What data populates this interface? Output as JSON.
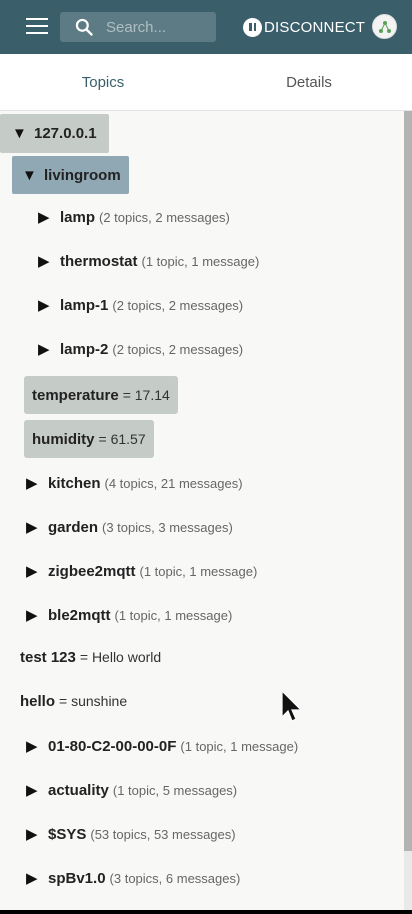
{
  "header": {
    "search_placeholder": "Search...",
    "disconnect_label": "DISCONNECT",
    "icons": {
      "menu": "menu-icon",
      "search": "search-icon",
      "pause": "pause-icon",
      "avatar": "avatar-icon"
    }
  },
  "tabs": [
    {
      "label": "Topics",
      "active": true
    },
    {
      "label": "Details",
      "active": false
    }
  ],
  "tree": {
    "broker": "127.0.0.1",
    "livingroom": {
      "name": "livingroom",
      "children": [
        {
          "name": "lamp",
          "meta": "(2 topics, 2 messages)"
        },
        {
          "name": "thermostat",
          "meta": "(1 topic, 1 message)"
        },
        {
          "name": "lamp-1",
          "meta": "(2 topics, 2 messages)"
        },
        {
          "name": "lamp-2",
          "meta": "(2 topics, 2 messages)"
        }
      ],
      "values": [
        {
          "name": "temperature",
          "value": "= 17.14"
        },
        {
          "name": "humidity",
          "value": "= 61.57"
        }
      ]
    },
    "groups": [
      {
        "name": "kitchen",
        "meta": "(4 topics, 21 messages)"
      },
      {
        "name": "garden",
        "meta": "(3 topics, 3 messages)"
      },
      {
        "name": "zigbee2mqtt",
        "meta": "(1 topic, 1 message)"
      },
      {
        "name": "ble2mqtt",
        "meta": "(1 topic, 1 message)"
      }
    ],
    "leaf_values": [
      {
        "name": "test 123",
        "value": "= Hello world"
      },
      {
        "name": "hello",
        "value": "= sunshine"
      }
    ],
    "more_groups": [
      {
        "name": "01-80-C2-00-00-0F",
        "meta": "(1 topic, 1 message)"
      },
      {
        "name": "actuality",
        "meta": "(1 topic, 5 messages)"
      },
      {
        "name": "$SYS",
        "meta": "(53 topics, 53 messages)"
      },
      {
        "name": "spBv1.0",
        "meta": "(3 topics, 6 messages)"
      }
    ]
  },
  "colors": {
    "appbar": "#3a5f6b",
    "selected_root": "#c5cbc7",
    "selected_child": "#8fa8b4"
  }
}
